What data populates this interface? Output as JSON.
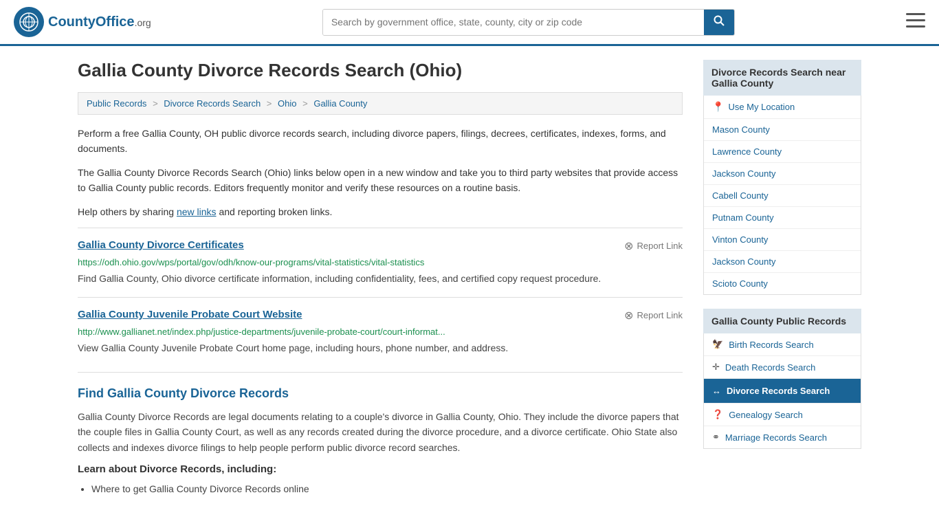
{
  "header": {
    "logo_text": "CountyOffice",
    "logo_suffix": ".org",
    "search_placeholder": "Search by government office, state, county, city or zip code"
  },
  "page": {
    "title": "Gallia County Divorce Records Search (Ohio)",
    "breadcrumbs": [
      {
        "label": "Public Records",
        "href": "#"
      },
      {
        "label": "Divorce Records Search",
        "href": "#"
      },
      {
        "label": "Ohio",
        "href": "#"
      },
      {
        "label": "Gallia County",
        "href": "#"
      }
    ],
    "intro1": "Perform a free Gallia County, OH public divorce records search, including divorce papers, filings, decrees, certificates, indexes, forms, and documents.",
    "intro2": "The Gallia County Divorce Records Search (Ohio) links below open in a new window and take you to third party websites that provide access to Gallia County public records. Editors frequently monitor and verify these resources on a routine basis.",
    "intro3_prefix": "Help others by sharing ",
    "new_links_text": "new links",
    "intro3_suffix": " and reporting broken links.",
    "links": [
      {
        "title": "Gallia County Divorce Certificates",
        "url": "https://odh.ohio.gov/wps/portal/gov/odh/know-our-programs/vital-statistics/vital-statistics",
        "description": "Find Gallia County, Ohio divorce certificate information, including confidentiality, fees, and certified copy request procedure.",
        "report_label": "Report Link"
      },
      {
        "title": "Gallia County Juvenile Probate Court Website",
        "url": "http://www.gallianet.net/index.php/justice-departments/juvenile-probate-court/court-informat...",
        "description": "View Gallia County Juvenile Probate Court home page, including hours, phone number, and address.",
        "report_label": "Report Link"
      }
    ],
    "find_section": {
      "heading": "Find Gallia County Divorce Records",
      "paragraph": "Gallia County Divorce Records are legal documents relating to a couple's divorce in Gallia County, Ohio. They include the divorce papers that the couple files in Gallia County Court, as well as any records created during the divorce procedure, and a divorce certificate. Ohio State also collects and indexes divorce filings to help people perform public divorce record searches.",
      "subheading": "Learn about Divorce Records, including:",
      "items": [
        "Where to get Gallia County Divorce Records online"
      ]
    }
  },
  "sidebar": {
    "nearby_heading": "Divorce Records Search near Gallia County",
    "location_label": "Use My Location",
    "nearby_counties": [
      "Mason County",
      "Lawrence County",
      "Jackson County",
      "Cabell County",
      "Putnam County",
      "Vinton County",
      "Jackson County",
      "Scioto County"
    ],
    "public_records_heading": "Gallia County Public Records",
    "public_records": [
      {
        "icon": "🦅",
        "label": "Birth Records Search",
        "active": false
      },
      {
        "icon": "+",
        "label": "Death Records Search",
        "active": false
      },
      {
        "icon": "↔",
        "label": "Divorce Records Search",
        "active": true
      },
      {
        "icon": "?",
        "label": "Genealogy Search",
        "active": false
      },
      {
        "icon": "⚭",
        "label": "Marriage Records Search",
        "active": false
      }
    ]
  }
}
